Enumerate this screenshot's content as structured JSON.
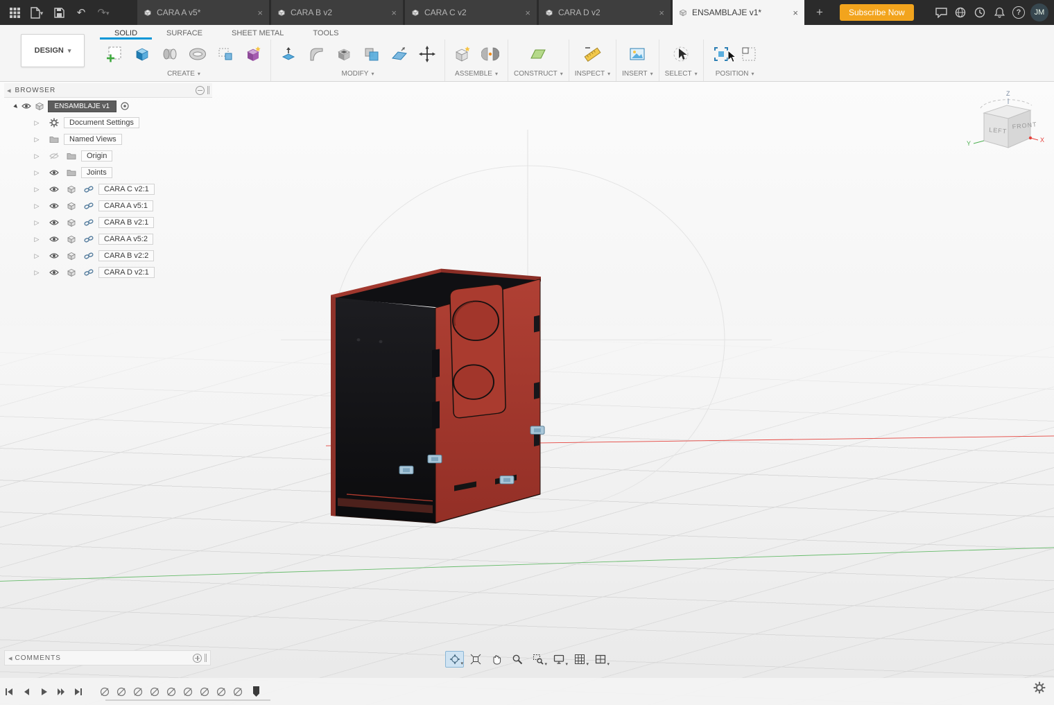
{
  "topbar": {
    "tabs": [
      {
        "label": "CARA A v5*"
      },
      {
        "label": "CARA B v2"
      },
      {
        "label": "CARA C v2"
      },
      {
        "label": "CARA D v2"
      },
      {
        "label": "ENSAMBLAJE v1*"
      }
    ],
    "subscribe": "Subscribe Now",
    "avatar": "JM"
  },
  "ribbon": {
    "workspace": "DESIGN",
    "tabs": [
      {
        "label": "SOLID"
      },
      {
        "label": "SURFACE"
      },
      {
        "label": "SHEET METAL"
      },
      {
        "label": "TOOLS"
      }
    ],
    "groups": [
      {
        "label": "CREATE"
      },
      {
        "label": "MODIFY"
      },
      {
        "label": "ASSEMBLE"
      },
      {
        "label": "CONSTRUCT"
      },
      {
        "label": "INSPECT"
      },
      {
        "label": "INSERT"
      },
      {
        "label": "SELECT"
      },
      {
        "label": "POSITION"
      }
    ]
  },
  "browser": {
    "title": "BROWSER",
    "root": "ENSAMBLAJE v1",
    "items": [
      {
        "label": "Document Settings"
      },
      {
        "label": "Named Views"
      },
      {
        "label": "Origin"
      },
      {
        "label": "Joints"
      },
      {
        "label": "CARA C v2:1"
      },
      {
        "label": "CARA  A v5:1"
      },
      {
        "label": "CARA B v2:1"
      },
      {
        "label": "CARA  A v5:2"
      },
      {
        "label": "CARA B v2:2"
      },
      {
        "label": "CARA D v2:1"
      }
    ]
  },
  "viewcube": {
    "left": "LEFT",
    "front": "FRONT",
    "x": "X",
    "y": "Y",
    "z": "Z"
  },
  "comments": {
    "title": "COMMENTS"
  },
  "colors": {
    "accent": "#0696d7",
    "subscribe_orange": "#f2a41d",
    "model_red": "#a8392e",
    "axis_green": "#66bb6a",
    "axis_red": "#e5433d"
  }
}
